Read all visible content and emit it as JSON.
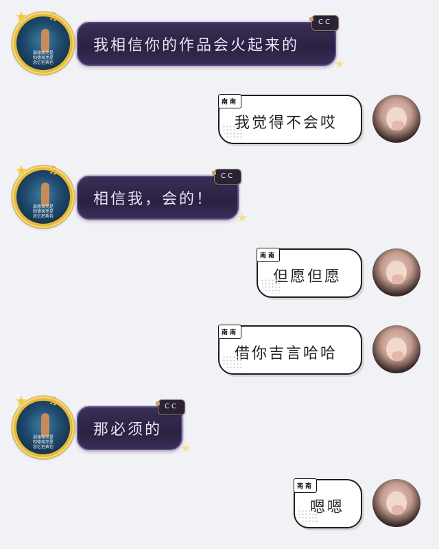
{
  "messages": [
    {
      "side": "left",
      "text": "我相信你的作品会火起来的",
      "badge": "CC"
    },
    {
      "side": "right",
      "text": "我觉得不会哎",
      "name": "南南"
    },
    {
      "side": "left",
      "text": "相信我，会的！",
      "badge": "CC"
    },
    {
      "side": "right",
      "text": "但愿但愿",
      "name": "南南"
    },
    {
      "side": "right",
      "text": "借你吉言哈哈",
      "name": "南南"
    },
    {
      "side": "left",
      "text": "那必须的",
      "badge": "CC"
    },
    {
      "side": "right",
      "text": "嗯嗯",
      "name": "南南"
    }
  ],
  "left_avatar": {
    "caption_lines": [
      "弱德夷亮是",
      "制德夷亮是",
      "念忆把典包"
    ]
  },
  "theme": {
    "left_bubble_color": "#2a2142",
    "right_bubble_color": "#ffffff",
    "background": "#f1f2f6"
  },
  "icons": {
    "left_frame": "star-frame-icon",
    "bubble_corner": "star-icon"
  }
}
